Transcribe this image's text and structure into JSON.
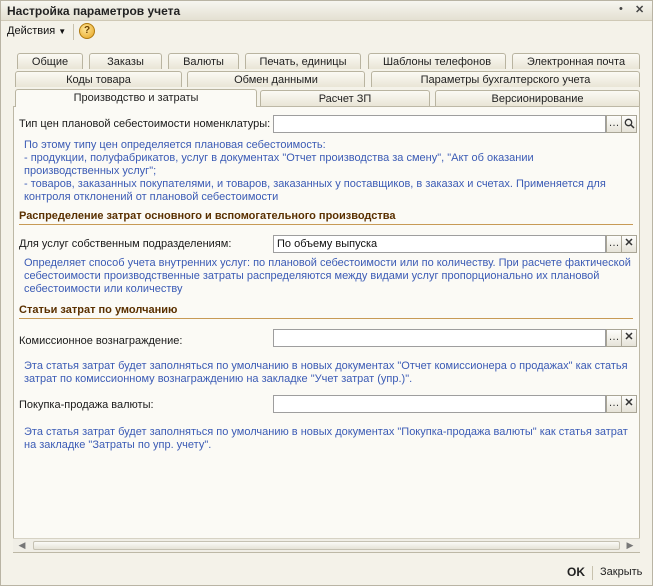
{
  "window": {
    "title": "Настройка параметров учета"
  },
  "toolbar": {
    "actions_label": "Действия",
    "help_glyph": "?"
  },
  "tabs": {
    "row1": [
      "Общие",
      "Заказы",
      "Валюты",
      "Печать, единицы",
      "Шаблоны телефонов",
      "Электронная почта"
    ],
    "row2": [
      "Коды товара",
      "Обмен данными",
      "Параметры бухгалтерского учета"
    ],
    "row3": [
      "Производство и затраты",
      "Расчет ЗП",
      "Версионирование"
    ]
  },
  "production": {
    "cost_price_type": {
      "label": "Тип цен плановой себестоимости номенклатуры:",
      "value": "",
      "note": [
        "По этому типу цен определяется плановая себестоимость:",
        "- продукции, полуфабрикатов, услуг в документах \"Отчет производства за смену\", \"Акт об оказании",
        "производственных услуг\";",
        "- товаров, заказанных покупателями, и товаров, заказанных у поставщиков, в заказах и счетах. Применяется для",
        "контроля отклонений от плановой себестоимости"
      ]
    },
    "section_distribution": "Распределение затрат основного и вспомогательного производства",
    "own_units": {
      "label": "Для услуг собственным подразделениям:",
      "value": "По объему выпуска",
      "note": [
        "Определяет способ учета внутренних услуг: по плановой себестоимости или по количеству. При расчете фактической",
        "себестоимости производственные затраты распределяются между видами услуг пропорционально их плановой",
        "себестоимости или количеству"
      ]
    },
    "section_default_items": "Статьи затрат по умолчанию",
    "commission": {
      "label": "Комиссионное вознаграждение:",
      "value": "",
      "note": [
        "Эта статья затрат будет заполняться по умолчанию в новых документах \"Отчет комиссионера о продажах\" как статья",
        "затрат по комиссионному вознаграждению на закладке \"Учет затрат (упр.)\"."
      ]
    },
    "currency": {
      "label": "Покупка-продажа валюты:",
      "value": "",
      "note": [
        "Эта статья затрат будет заполняться по умолчанию в новых документах \"Покупка-продажа валюты\" как статья затрат",
        "на закладке \"Затраты по упр. учету\"."
      ]
    }
  },
  "footer": {
    "ok_label": "OK",
    "close_label": "Закрыть"
  },
  "icons": {
    "dropdown": "chevron-down-icon",
    "search": "search-icon",
    "clear": "clear-x-icon",
    "ellipsis": "ellipsis-icon"
  }
}
